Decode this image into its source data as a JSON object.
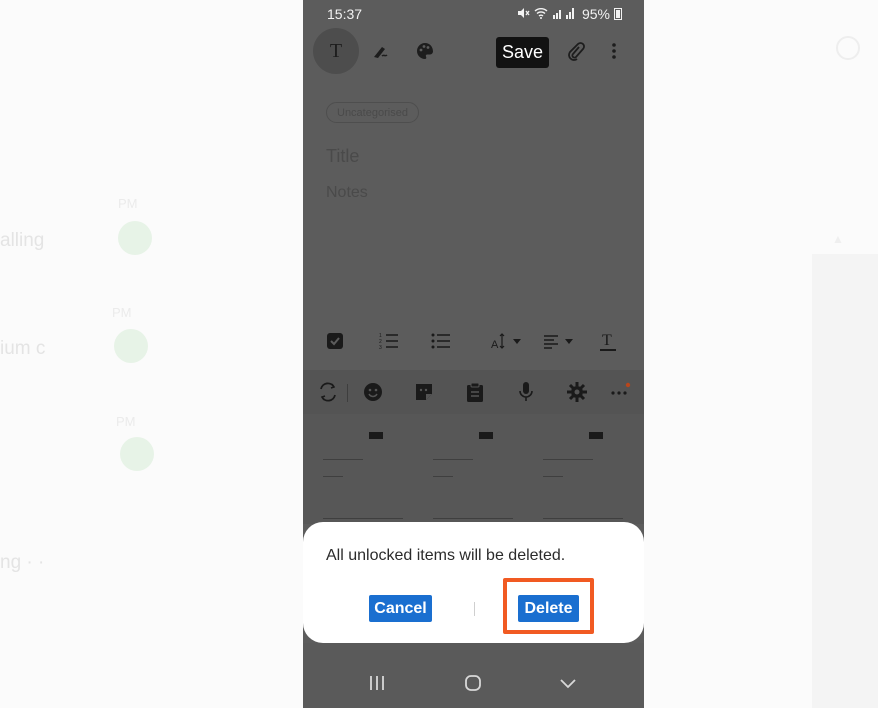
{
  "background": {
    "left_labels": [
      "alling",
      "ium c",
      "ng ·  ·"
    ],
    "left_small": [
      "PM",
      "PM",
      "PM"
    ]
  },
  "status_bar": {
    "time": "15:37",
    "battery": "95%"
  },
  "editor_toolbar": {
    "save_label": "Save"
  },
  "note": {
    "category_chip": "Uncategorised",
    "title_placeholder": "Title",
    "notes_placeholder": "Notes"
  },
  "dialog": {
    "message": "All unlocked items will be deleted.",
    "cancel_label": "Cancel",
    "delete_label": "Delete"
  },
  "colors": {
    "accent_blue": "#1a6fd0",
    "highlight_orange": "#f15a22",
    "overlay_grey": "#5c5c5c"
  }
}
